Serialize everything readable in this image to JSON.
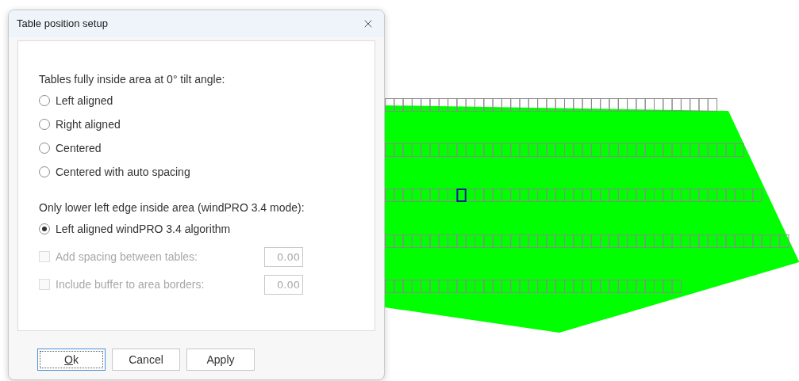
{
  "window": {
    "title": "Table position setup"
  },
  "groups": [
    {
      "heading": "Tables fully inside area at 0° tilt angle:",
      "options": [
        {
          "label": "Left aligned",
          "selected": false
        },
        {
          "label": "Right aligned",
          "selected": false
        },
        {
          "label": "Centered",
          "selected": false
        },
        {
          "label": "Centered with auto spacing",
          "selected": false
        }
      ]
    },
    {
      "heading": "Only lower left edge inside area (windPRO 3.4 mode):",
      "options": [
        {
          "label": "Left aligned windPRO 3.4 algorithm",
          "selected": true
        }
      ]
    }
  ],
  "extra_options": [
    {
      "label": "Add spacing between tables:",
      "checked": false,
      "disabled": true,
      "value": "0.00"
    },
    {
      "label": "Include buffer to area borders:",
      "checked": false,
      "disabled": true,
      "value": "0.00"
    }
  ],
  "buttons": [
    {
      "label": "Ok",
      "focused": true,
      "underline_first": true
    },
    {
      "label": "Cancel",
      "focused": false,
      "underline_first": false
    },
    {
      "label": "Apply",
      "focused": false,
      "underline_first": false
    }
  ]
}
